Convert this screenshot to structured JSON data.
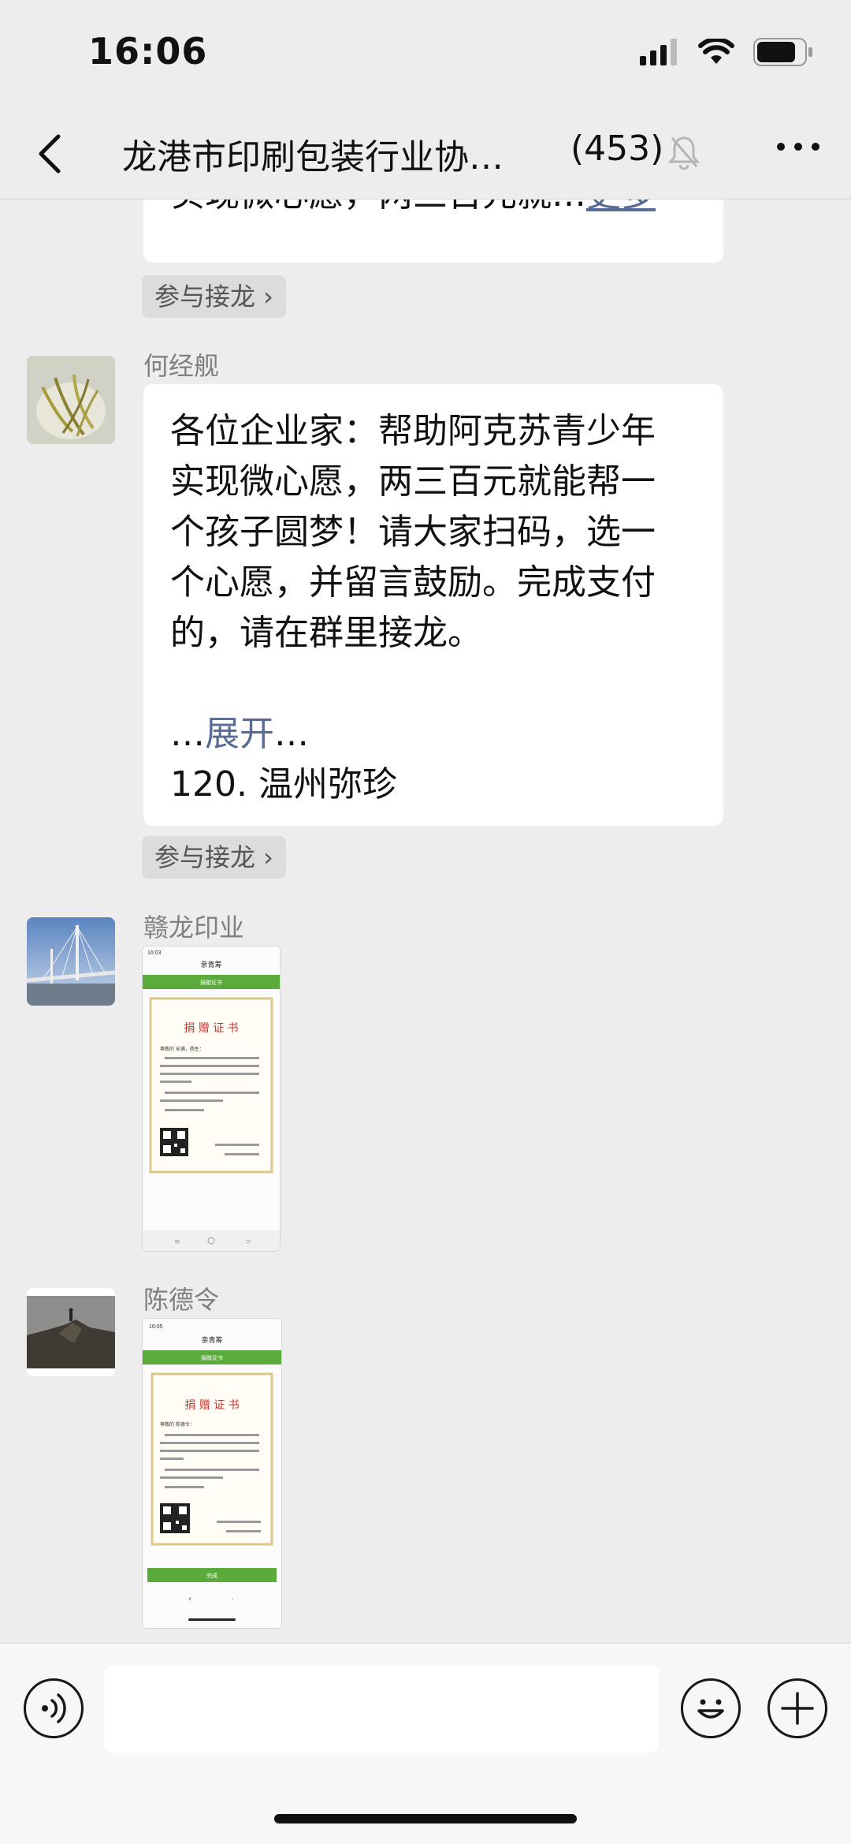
{
  "status": {
    "time": "16:06"
  },
  "nav": {
    "title": "龙港市印刷包装行业协…",
    "count": "(453)"
  },
  "messages": {
    "prev_text": "实现微心愿，两三百元就…",
    "prev_more": "更多",
    "join1": "参与接龙 ›",
    "msg1": {
      "sender": "何经舰",
      "line1": "各位企业家：帮助阿克苏青少年",
      "line2": "实现微心愿，两三百元就能帮一",
      "line3": "个孩子圆梦！请大家扫码，选一",
      "line4": "个心愿，并留言鼓励。完成支付",
      "line5": "的，请在群里接龙。",
      "ellipsis_pre": "…",
      "expand": "展开",
      "ellipsis_post": "…",
      "last": "120. 温州弥珍"
    },
    "join2": "参与接龙 ›",
    "msg2": {
      "sender": "赣龙印业"
    },
    "msg3": {
      "sender": "陈德令"
    }
  },
  "thumb1": {
    "time": "16:03",
    "app": "亲青筹",
    "bar": "捐赠证书",
    "cert_title": "捐 赠 证 书",
    "greet": "尊敬的 安满，杨生：",
    "body": "感谢您参与“2022圆梦阿克苏一万微心愿爱心行动”，助力青少年实现梦想，用爱心开启他们未来之路！",
    "body2": "您已在亲青筹公益平台累计奉献爱心1次，捐款 200 元。",
    "body3": "特颁此证，谨致谢忱！",
    "org": "浙江省青少年发展基金会",
    "date": "2022年 7月 7日"
  },
  "thumb2": {
    "time": "16:05",
    "app": "亲青筹",
    "bar": "捐赠证书",
    "cert_title": "捐 赠 证 书",
    "greet": "尊敬的 陈德令：",
    "body": "感谢您参与“2022圆梦阿克苏一万微心愿爱心行动”，助力青少年实现梦想，用爱心开启他们未来之路！",
    "body2": "您已在亲青筹公益平台累计奉献爱心1次，捐款 280 元。",
    "body3": "特颁此证，谨致谢忱！",
    "org": "浙江省青少年发展基金会",
    "date": "2022年 7月 7日",
    "btn": "完成"
  }
}
